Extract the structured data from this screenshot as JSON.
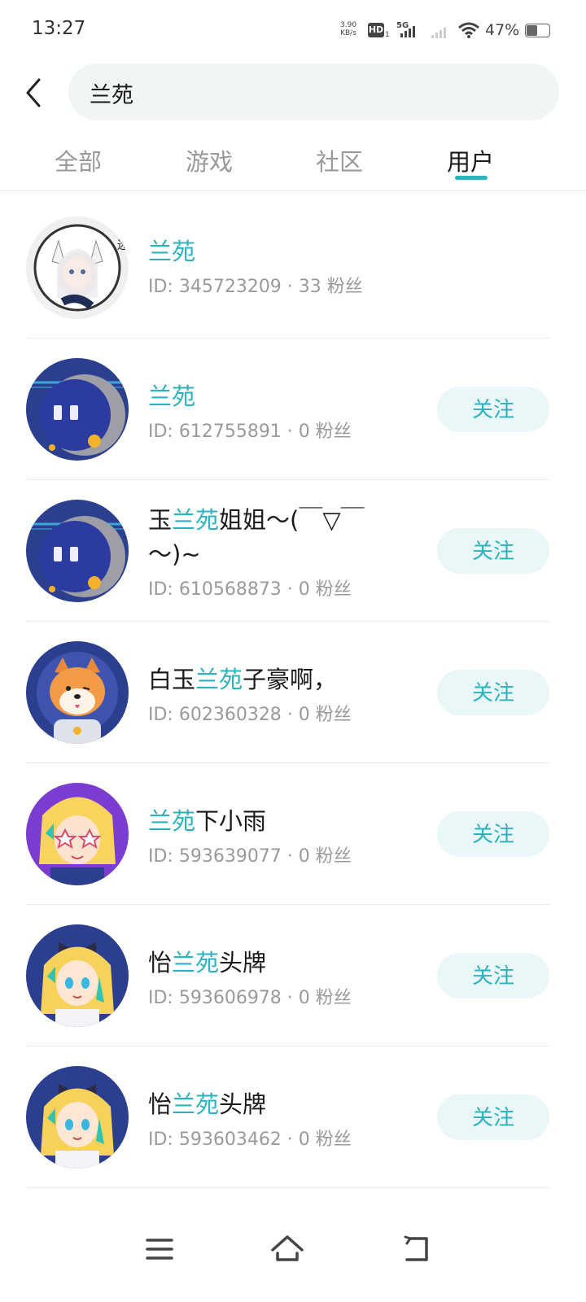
{
  "status_bar": {
    "time": "13:27",
    "net_speed_value": "3.90",
    "net_speed_unit": "KB/s",
    "hd": "HD",
    "hd_sub": "1",
    "network": "5G",
    "battery": "47%"
  },
  "search": {
    "value": "兰苑"
  },
  "tabs": [
    {
      "label": "全部"
    },
    {
      "label": "游戏"
    },
    {
      "label": "社区"
    },
    {
      "label": "用户",
      "active": true
    }
  ],
  "highlight_color": "#2bb3c0",
  "follow_label": "关注",
  "users": [
    {
      "name_pre": "",
      "name_hl": "兰苑",
      "name_post": "",
      "meta": "ID: 345723209 · 33 粉丝",
      "avatar": "fox-girl-avatar",
      "follow": false
    },
    {
      "name_pre": "",
      "name_hl": "兰苑",
      "name_post": "",
      "meta": "ID: 612755891 · 0 粉丝",
      "avatar": "robot-avatar",
      "follow": true
    },
    {
      "name_pre": "玉",
      "name_hl": "兰苑",
      "name_post": "姐姐～(￣▽￣～)~",
      "meta": "ID: 610568873 · 0 粉丝",
      "avatar": "robot-avatar",
      "follow": true
    },
    {
      "name_pre": "白玉",
      "name_hl": "兰苑",
      "name_post": "子豪啊，",
      "meta": "ID: 602360328 · 0 粉丝",
      "avatar": "shiba-astronaut-avatar",
      "follow": true
    },
    {
      "name_pre": "",
      "name_hl": "兰苑",
      "name_post": "下小雨",
      "meta": "ID: 593639077 · 0 粉丝",
      "avatar": "star-glasses-girl-avatar",
      "follow": true
    },
    {
      "name_pre": "怡",
      "name_hl": "兰苑",
      "name_post": "头牌",
      "meta": "ID: 593606978 · 0 粉丝",
      "avatar": "bow-girl-avatar",
      "follow": true
    },
    {
      "name_pre": "怡",
      "name_hl": "兰苑",
      "name_post": "头牌",
      "meta": "ID: 593603462 · 0 粉丝",
      "avatar": "bow-girl-avatar",
      "follow": true
    }
  ],
  "nav": [
    "menu-icon",
    "home-icon",
    "back-icon"
  ]
}
